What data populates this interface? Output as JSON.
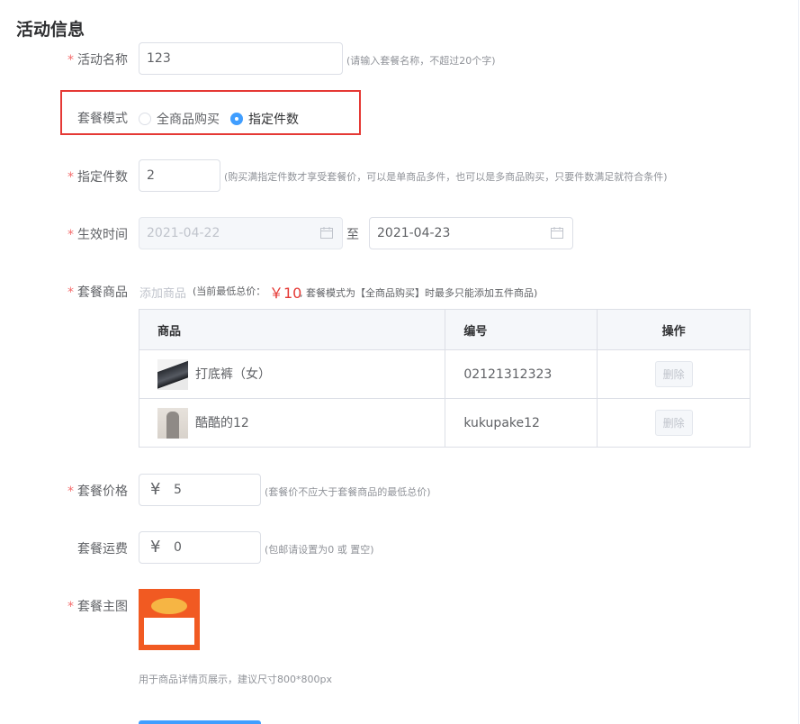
{
  "section_title": "活动信息",
  "activity_name": {
    "label": "活动名称",
    "value": "123",
    "hint": "(请输入套餐名称，不超过20个字)"
  },
  "mode": {
    "label": "套餐模式",
    "options": [
      "全商品购买",
      "指定件数"
    ],
    "selected": "指定件数"
  },
  "count": {
    "label": "指定件数",
    "value": "2",
    "hint": "(购买满指定件数才享受套餐价，可以是单商品多件，也可以是多商品购买，只要件数满足就符合条件)"
  },
  "period": {
    "label": "生效时间",
    "start": "2021-04-22",
    "separator": "至",
    "end": "2021-04-23"
  },
  "goods": {
    "label": "套餐商品",
    "add_link": "添加商品",
    "tip_prefix": "(当前最低总价：",
    "min_price": "￥10",
    "tip_suffix": ", 套餐模式为【全商品购买】时最多只能添加五件商品)",
    "columns": [
      "商品",
      "编号",
      "操作"
    ],
    "rows": [
      {
        "name": "打底裤（女）",
        "code": "02121312323",
        "action": "删除"
      },
      {
        "name": "酷酷的12",
        "code": "kukupake12",
        "action": "删除"
      }
    ]
  },
  "price": {
    "label": "套餐价格",
    "currency": "¥",
    "value": "5",
    "hint": "(套餐价不应大于套餐商品的最低总价)"
  },
  "shipping": {
    "label": "套餐运费",
    "currency": "¥",
    "value": "0",
    "hint": "(包邮请设置为0 或 置空)"
  },
  "cover": {
    "label": "套餐主图",
    "hint": "用于商品详情页展示，建议尺寸800*800px"
  },
  "colors": {
    "primary": "#409eff",
    "required": "#f56c6c",
    "highlight_border": "#e53935",
    "price_red": "#e53935",
    "cover_bg": "#f15a22"
  }
}
